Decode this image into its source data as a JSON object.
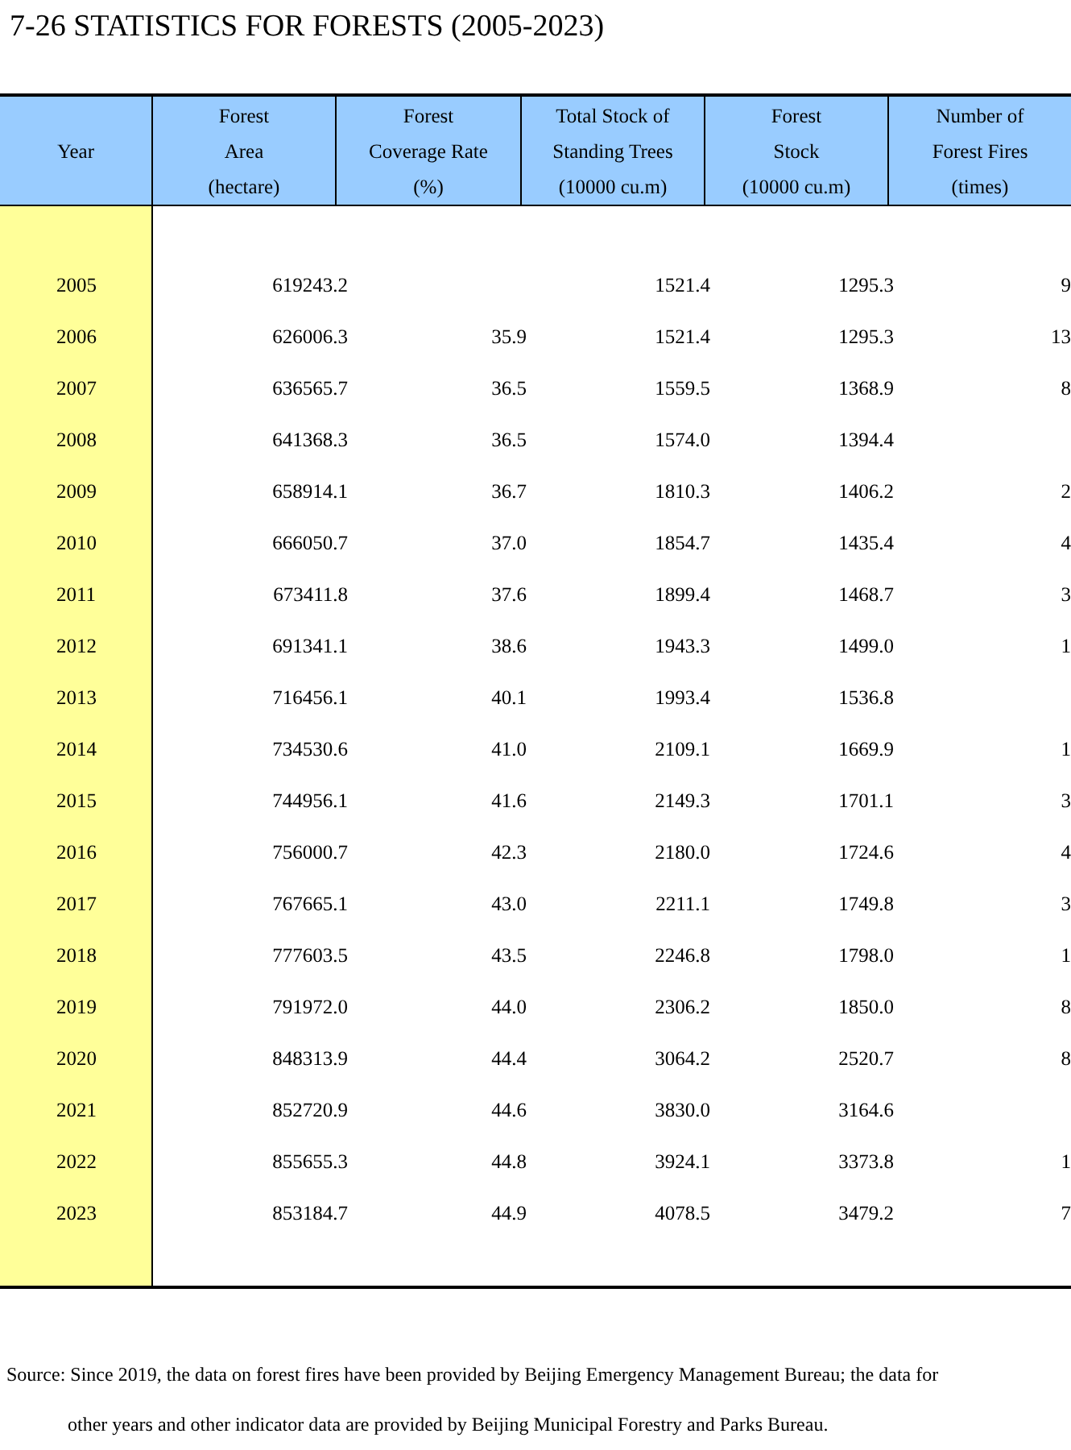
{
  "title": "7-26  STATISTICS FOR FORESTS (2005-2023)",
  "table": {
    "columns": [
      "Year",
      "Forest\nArea\n(hectare)",
      "Forest\nCoverage Rate\n(%)",
      "Total Stock of\nStanding Trees\n(10000 cu.m)",
      "Forest\nStock\n(10000 cu.m)",
      "Number of\nForest Fires\n(times)"
    ],
    "rows": [
      [
        "2005",
        "619243.2",
        null,
        "1521.4",
        "1295.3",
        "9"
      ],
      [
        "2006",
        "626006.3",
        "35.9",
        "1521.4",
        "1295.3",
        "13"
      ],
      [
        "2007",
        "636565.7",
        "36.5",
        "1559.5",
        "1368.9",
        "8"
      ],
      [
        "2008",
        "641368.3",
        "36.5",
        "1574.0",
        "1394.4",
        null
      ],
      [
        "2009",
        "658914.1",
        "36.7",
        "1810.3",
        "1406.2",
        "2"
      ],
      [
        "2010",
        "666050.7",
        "37.0",
        "1854.7",
        "1435.4",
        "4"
      ],
      [
        "2011",
        "673411.8",
        "37.6",
        "1899.4",
        "1468.7",
        "3"
      ],
      [
        "2012",
        "691341.1",
        "38.6",
        "1943.3",
        "1499.0",
        "1"
      ],
      [
        "2013",
        "716456.1",
        "40.1",
        "1993.4",
        "1536.8",
        null
      ],
      [
        "2014",
        "734530.6",
        "41.0",
        "2109.1",
        "1669.9",
        "1"
      ],
      [
        "2015",
        "744956.1",
        "41.6",
        "2149.3",
        "1701.1",
        "3"
      ],
      [
        "2016",
        "756000.7",
        "42.3",
        "2180.0",
        "1724.6",
        "4"
      ],
      [
        "2017",
        "767665.1",
        "43.0",
        "2211.1",
        "1749.8",
        "3"
      ],
      [
        "2018",
        "777603.5",
        "43.5",
        "2246.8",
        "1798.0",
        "1"
      ],
      [
        "2019",
        "791972.0",
        "44.0",
        "2306.2",
        "1850.0",
        "8"
      ],
      [
        "2020",
        "848313.9",
        "44.4",
        "3064.2",
        "2520.7",
        "8"
      ],
      [
        "2021",
        "852720.9",
        "44.6",
        "3830.0",
        "3164.6",
        null
      ],
      [
        "2022",
        "855655.3",
        "44.8",
        "3924.1",
        "3373.8",
        "1"
      ],
      [
        "2023",
        "853184.7",
        "44.9",
        "4078.5",
        "3479.2",
        "7"
      ]
    ]
  },
  "source_note": [
    "Source: Since 2019, the data on forest fires have been provided by Beijing Emergency Management Bureau; the data for",
    "other years and other indicator data are provided by Beijing Municipal Forestry and Parks Bureau."
  ]
}
